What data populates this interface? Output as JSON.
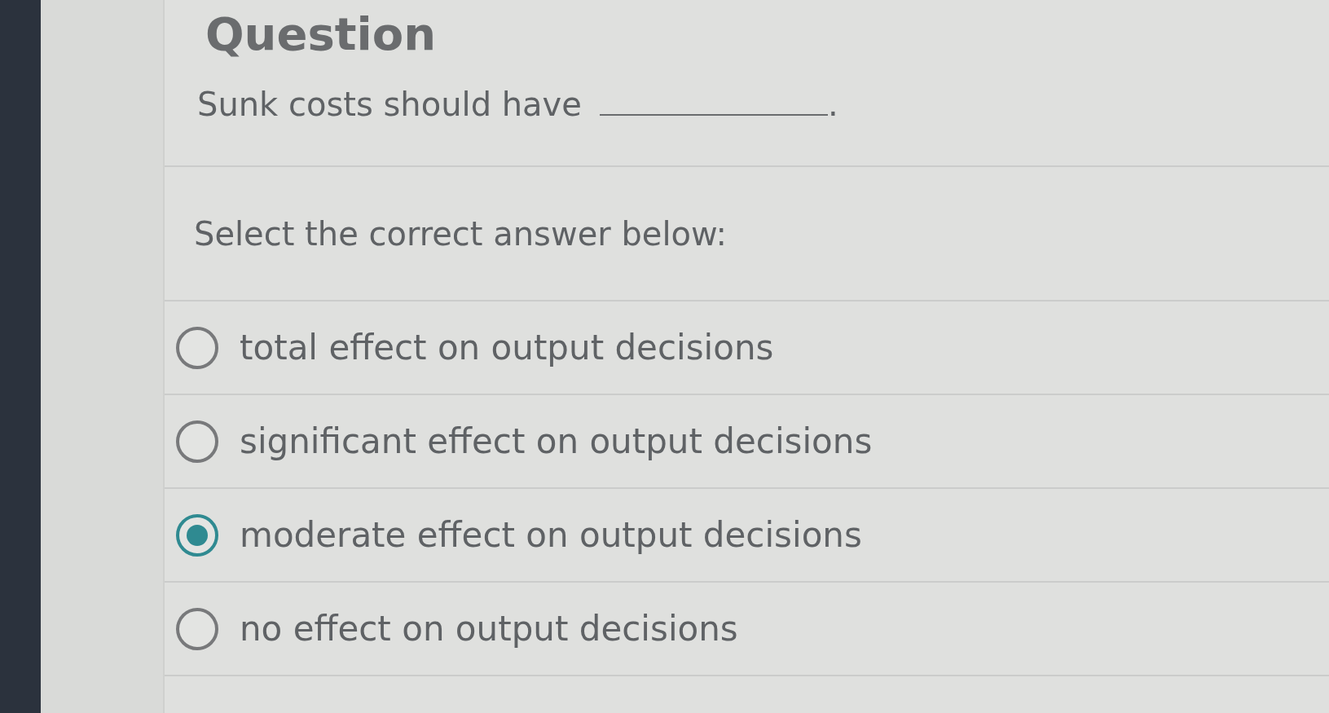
{
  "title": "Question",
  "question": {
    "text_before_blank": "Sunk costs should have",
    "text_after_blank": "."
  },
  "instruction": "Select the correct answer below:",
  "options": [
    {
      "label": "total effect on output decisions",
      "selected": false
    },
    {
      "label": "significant effect on output decisions",
      "selected": false
    },
    {
      "label": "moderate effect on output decisions",
      "selected": true
    },
    {
      "label": "no effect on output decisions",
      "selected": false
    }
  ]
}
